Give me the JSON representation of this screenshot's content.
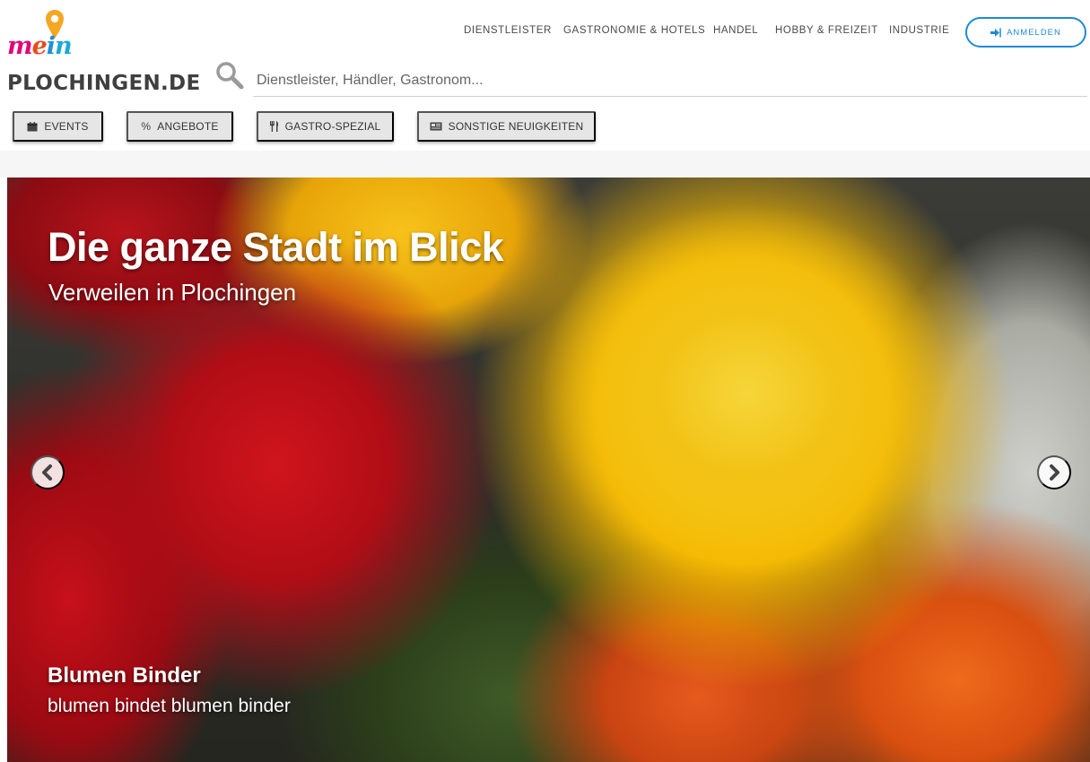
{
  "logo": {
    "word_m": "m",
    "word_e": "e",
    "word_i": "i",
    "word_n": "n",
    "site_name": "PLOCHINGEN.DE",
    "pin_color": "#f5a623"
  },
  "search": {
    "placeholder": "Dienstleister, Händler, Gastronom..."
  },
  "topnav": {
    "items": [
      {
        "label": "DIENSTLEISTER"
      },
      {
        "label": "GASTRONOMIE & HOTELS"
      },
      {
        "label": "HANDEL"
      },
      {
        "label": "HOBBY & FREIZEIT"
      },
      {
        "label": "INDUSTRIE"
      }
    ],
    "login": {
      "label": "ANMELDEN",
      "icon": "sign-in-icon"
    }
  },
  "categories": [
    {
      "label": "EVENTS",
      "icon": "calendar-icon"
    },
    {
      "label": "ANGEBOTE",
      "icon": "percent-icon"
    },
    {
      "label": "GASTRO-SPEZIAL",
      "icon": "cutlery-icon"
    },
    {
      "label": "SONSTIGE NEUIGKEITEN",
      "icon": "newspaper-icon"
    }
  ],
  "hero": {
    "title": "Die ganze Stadt im Blick",
    "subtitle": "Verweilen in Plochingen",
    "caption_title": "Blumen Binder",
    "caption_subtitle": "blumen bindet blumen binder",
    "prev_icon": "chevron-left-icon",
    "next_icon": "chevron-right-icon"
  },
  "colors": {
    "accent": "#1e8ad6",
    "logo_magenta": "#e3007a",
    "logo_orange": "#e74c1c",
    "logo_blue": "#1f8fd6",
    "text_dark": "#3f3f3f"
  }
}
